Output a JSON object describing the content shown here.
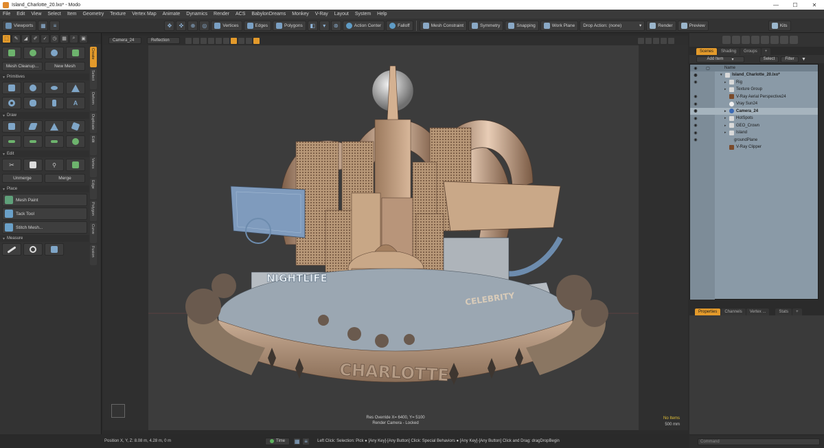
{
  "window": {
    "title": "Island_Charlotte_20.lxo* - Modo",
    "minimize_glyph": "—",
    "maximize_glyph": "☐",
    "close_glyph": "✕"
  },
  "menu": [
    "File",
    "Edit",
    "View",
    "Select",
    "Item",
    "Geometry",
    "Texture",
    "Vertex Map",
    "Animate",
    "Dynamics",
    "Render",
    "ACS",
    "BabylonDreams",
    "Monkey",
    "V-Ray",
    "Layout",
    "System",
    "Help"
  ],
  "toolbar": {
    "viewports": "Viewports",
    "vertices": "Vertices",
    "edges": "Edges",
    "polygons": "Polygons",
    "action_center": "Action Center",
    "falloff": "Falloff",
    "mesh_constraint": "Mesh Constraint",
    "symmetry": "Symmetry",
    "snapping": "Snapping",
    "work_plane": "Work Plane",
    "drop_action": "Drop Action: (none)",
    "render": "Render",
    "preview": "Preview",
    "kits": "Kits"
  },
  "left_panel": {
    "vertical_tabs": [
      "Create",
      "Select",
      "Deform",
      "Duplicate",
      "Edit",
      "Vertex",
      "Edge",
      "Polygon",
      "Curve",
      "Fusion"
    ],
    "mesh_cleanup": "Mesh Cleanup...",
    "new_mesh": "New Mesh",
    "sections": {
      "primitives": "Primitives",
      "draw": "Draw",
      "edit": "Edit",
      "place": "Place",
      "measure": "Measure"
    },
    "unmerge": "Unmerge",
    "merge": "Merge",
    "place_tools": [
      "Mesh Paint",
      "Tack Tool",
      "Stitch Mesh..."
    ]
  },
  "viewport": {
    "camera": "Camera_24",
    "shading": "Reflection",
    "res_override": "Res Override  X= 6400, Y= 5100",
    "render_camera": "Render Camera - Locked",
    "no_items": "No Items",
    "scale": "500 mm",
    "scene_text_1": "NIGHTLIFE",
    "scene_text_2": "CHARLOTTE",
    "scene_text_3": "CELEBRITY"
  },
  "right_panel": {
    "tabs": [
      "Scenes",
      "Shading",
      "Groups",
      "+"
    ],
    "add_item": "Add Item",
    "select": "Select",
    "filter": "Filter",
    "name_header": "Name",
    "tree": [
      {
        "label": "Island_Charlotte_20.lxo*",
        "indent": 0,
        "bold": true,
        "eye": true
      },
      {
        "label": "Rig",
        "indent": 1,
        "bold": false,
        "eye": true
      },
      {
        "label": "Texture Group",
        "indent": 1,
        "bold": false,
        "eye": false
      },
      {
        "label": "V-Ray Aerial Perspective24",
        "indent": 1,
        "bold": false,
        "eye": true
      },
      {
        "label": "Vray Sun24",
        "indent": 1,
        "bold": false,
        "eye": true
      },
      {
        "label": "Camera_24",
        "indent": 1,
        "bold": true,
        "eye": true
      },
      {
        "label": "HotSpots",
        "indent": 1,
        "bold": false,
        "eye": true
      },
      {
        "label": "GEO_Crown",
        "indent": 1,
        "bold": false,
        "eye": true
      },
      {
        "label": "Island",
        "indent": 1,
        "bold": false,
        "eye": true
      },
      {
        "label": "groundPlane",
        "indent": 1,
        "bold": false,
        "eye": true
      },
      {
        "label": "V-Ray Clipper",
        "indent": 1,
        "bold": false,
        "eye": false
      }
    ],
    "props_tabs": [
      "Properties",
      "Channels",
      "Vertex ...",
      "Stats",
      "+"
    ],
    "command_placeholder": "Command"
  },
  "statusbar": {
    "position": "Position X, Y, Z:   8.08 m, 4.28 m, 0 m",
    "time": "Time",
    "hint": "Left Click: Selection: Pick ●   [Any Key]-[Any Button] Click: Special Behaviors ●   [Any Key]-[Any Button] Click and Drag: dragDropBegin"
  },
  "colors": {
    "accent": "#e39a2b",
    "outliner_bg": "#8a9aa7",
    "viewport_bg": "#3c3c3c"
  }
}
